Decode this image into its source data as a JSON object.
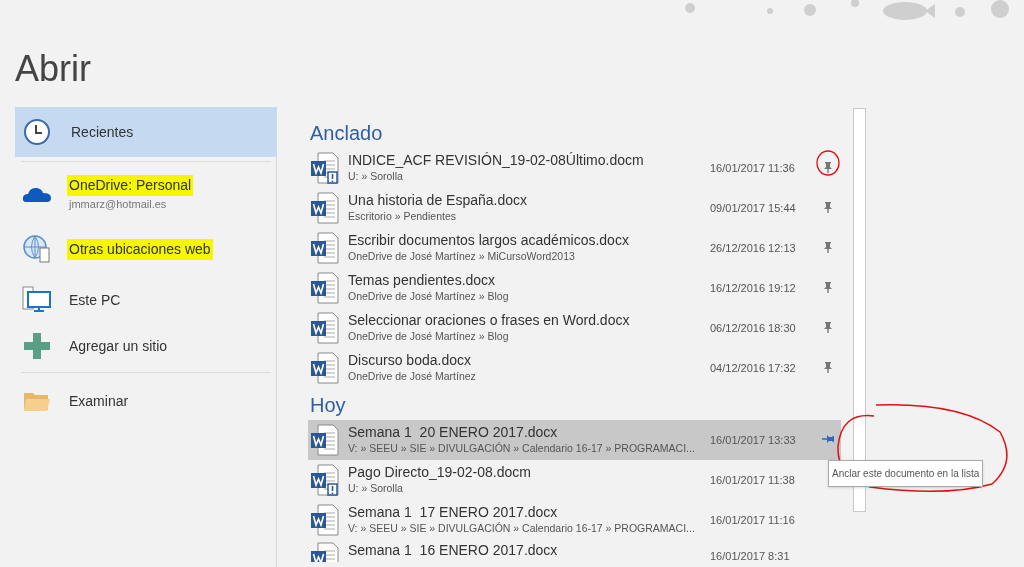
{
  "heading": "Abrir",
  "places": [
    {
      "kind": "recent",
      "label": "Recientes",
      "selected": true,
      "highlighted": false
    },
    {
      "kind": "onedrive",
      "label": "OneDrive: Personal",
      "account": "jmmarz@hotmail.es",
      "selected": false,
      "highlighted": true
    },
    {
      "kind": "web",
      "label": "Otras ubicaciones web",
      "selected": false,
      "highlighted": true
    },
    {
      "kind": "pc",
      "label": "Este PC",
      "selected": false,
      "highlighted": false
    },
    {
      "kind": "add",
      "label": "Agregar un sitio",
      "selected": false,
      "highlighted": false
    },
    {
      "kind": "browse",
      "label": "Examinar",
      "selected": false,
      "highlighted": false
    }
  ],
  "groups": [
    {
      "title": "Anclado",
      "files": [
        {
          "name": "INDICE_ACF REVISIÓN_19-02-08Último.docm",
          "path": "U: » Sorolla",
          "date": "16/01/2017 11:36",
          "kind": "macro",
          "pinned": true,
          "selected": false,
          "circled": true
        },
        {
          "name": "Una historia de España.docx",
          "path": "Escritorio » Pendientes",
          "date": "09/01/2017 15:44",
          "kind": "doc",
          "pinned": true,
          "selected": false,
          "circled": false
        },
        {
          "name": "Escribir documentos largos académicos.docx",
          "path": "OneDrive de José Martínez » MiCursoWord2013",
          "date": "26/12/2016 12:13",
          "kind": "doc",
          "pinned": true,
          "selected": false,
          "circled": false
        },
        {
          "name": "Temas pendientes.docx",
          "path": "OneDrive de José Martínez » Blog",
          "date": "16/12/2016 19:12",
          "kind": "doc",
          "pinned": true,
          "selected": false,
          "circled": false
        },
        {
          "name": "Seleccionar oraciones o frases en Word.docx",
          "path": "OneDrive de José Martínez » Blog",
          "date": "06/12/2016 18:30",
          "kind": "doc",
          "pinned": true,
          "selected": false,
          "circled": false
        },
        {
          "name": "Discurso boda.docx",
          "path": "OneDrive de José Martínez",
          "date": "04/12/2016 17:32",
          "kind": "doc",
          "pinned": true,
          "selected": false,
          "circled": false
        }
      ]
    },
    {
      "title": "Hoy",
      "files": [
        {
          "name": "Semana 1  20 ENERO 2017.docx",
          "path": "V: » SEEU » SIE » DIVULGACIÓN » Calendario 16-17 » PROGRAMACI...",
          "date": "16/01/2017 13:33",
          "kind": "doc",
          "pinned": false,
          "selected": true,
          "circled": true,
          "tooltip": "Anclar este documento en la lista"
        },
        {
          "name": "Pago Directo_19-02-08.docm",
          "path": "U: » Sorolla",
          "date": "16/01/2017 11:38",
          "kind": "macro",
          "pinned": false,
          "selected": false,
          "circled": false
        },
        {
          "name": "Semana 1  17 ENERO 2017.docx",
          "path": "V: » SEEU » SIE » DIVULGACIÓN » Calendario 16-17 » PROGRAMACI...",
          "date": "16/01/2017 11:16",
          "kind": "doc",
          "pinned": false,
          "selected": false,
          "circled": false
        },
        {
          "name": "Semana 1  16 ENERO 2017.docx",
          "date": "16/01/2017 8:31",
          "kind": "doc",
          "pinned": false,
          "selected": false,
          "circled": false
        }
      ]
    }
  ]
}
